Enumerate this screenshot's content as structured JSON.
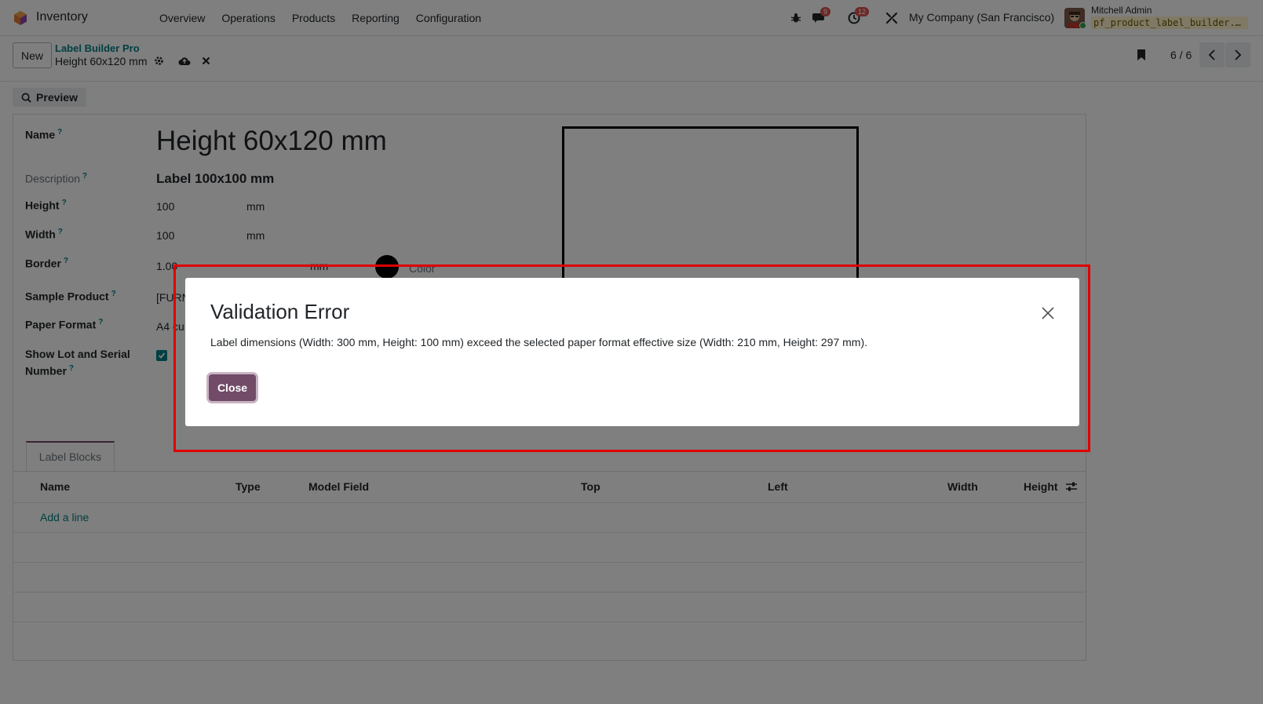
{
  "navbar": {
    "app_name": "Inventory",
    "menu": [
      "Overview",
      "Operations",
      "Products",
      "Reporting",
      "Configuration"
    ],
    "messages_badge": "9",
    "activities_badge": "12",
    "company": "My Company (San Francisco)",
    "user_name": "Mitchell Admin",
    "database": "pf_product_label_builder..."
  },
  "control_panel": {
    "new_label": "New",
    "breadcrumb_parent": "Label Builder Pro",
    "breadcrumb_current": "Height 60x120 mm",
    "pager": "6 / 6"
  },
  "form": {
    "preview_label": "Preview",
    "help_mark": "?",
    "fields": {
      "name_label": "Name",
      "name_value": "Height 60x120 mm",
      "description_label": "Description",
      "description_value": "Label 100x100 mm",
      "height_label": "Height",
      "height_value": "100",
      "width_label": "Width",
      "width_value": "100",
      "unit": "mm",
      "border_label": "Border",
      "border_value": "1.00",
      "color_label": "Color",
      "sample_product_label": "Sample Product",
      "sample_product_value": "[FURN",
      "paper_format_label": "Paper Format",
      "paper_format_value": "A4 cu",
      "lot_serial_label_line1": "Show Lot and Serial",
      "lot_serial_label_line2": "Number",
      "lot_serial_checked": true
    },
    "tab_label": "Label Blocks",
    "table_headers": [
      "Name",
      "Type",
      "Model Field",
      "Top",
      "Left",
      "Width",
      "Height"
    ],
    "add_line": "Add a line"
  },
  "dialog": {
    "title": "Validation Error",
    "message": "Label dimensions (Width: 300 mm, Height: 100 mm) exceed the selected paper format effective size (Width: 210 mm, Height: 297 mm).",
    "close_button": "Close"
  },
  "colors": {
    "accent": "#714b67",
    "link": "#017e84",
    "highlight": "#e00000"
  }
}
